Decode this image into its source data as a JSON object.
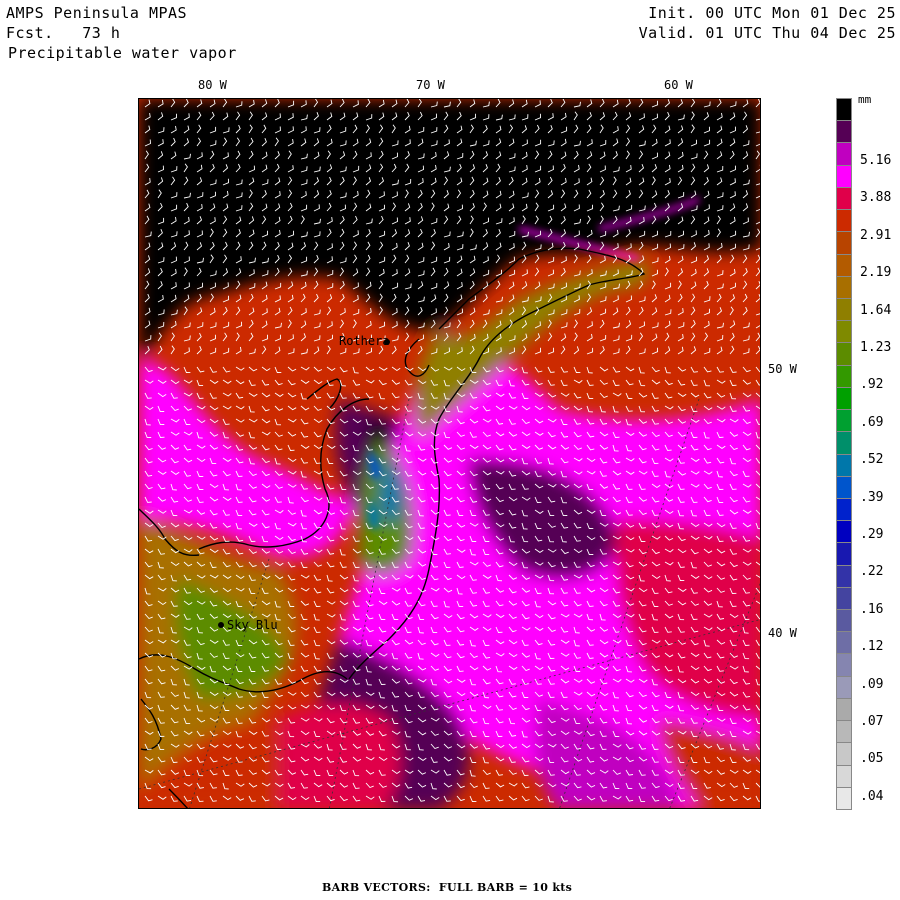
{
  "header": {
    "title": "AMPS Peninsula MPAS",
    "forecast": "Fcst.   73 h",
    "field": "Precipitable water vapor",
    "init": "Init. 00 UTC Mon 01 Dec 25",
    "valid": "Valid. 01 UTC Thu 04 Dec 25"
  },
  "map": {
    "top_lon_labels": [
      "80 W",
      "70 W",
      "60 W"
    ],
    "right_lat_labels": [
      "50 W",
      "40 W"
    ],
    "stations": [
      {
        "name": "Rothera"
      },
      {
        "name": "Sky Blu"
      }
    ]
  },
  "legend": {
    "units": "mm",
    "colors": [
      "#000000",
      "#550055",
      "#c000c0",
      "#ff00ff",
      "#e0004a",
      "#cc2a00",
      "#b84400",
      "#b35b00",
      "#a86f00",
      "#8f7f00",
      "#7f8a00",
      "#5c8c00",
      "#339900",
      "#00a000",
      "#00a030",
      "#008f6a",
      "#0077aa",
      "#0055cc",
      "#0022cc",
      "#0000c0",
      "#1818b0",
      "#3333a8",
      "#4444a0",
      "#5a5aa0",
      "#6e6ea6",
      "#8585b0",
      "#9a9ab8",
      "#aaaaaa",
      "#b8b8b8",
      "#c8c8c8",
      "#d8d8d8",
      "#e8e8e8"
    ],
    "labels": [
      "5.16",
      "3.88",
      "2.91",
      "2.19",
      "1.64",
      "1.23",
      ".92",
      ".69",
      ".52",
      ".39",
      ".29",
      ".22",
      ".16",
      ".12",
      ".09",
      ".07",
      ".05",
      ".04"
    ]
  },
  "footer": {
    "barb_text": "BARB VECTORS:  FULL BARB = 10 kts"
  }
}
